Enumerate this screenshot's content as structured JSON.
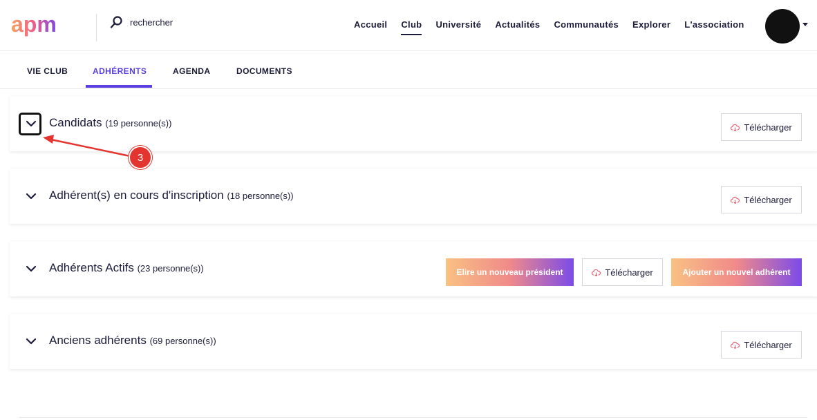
{
  "header": {
    "logo_text": "apm",
    "search": {
      "placeholder": "rechercher"
    },
    "nav": [
      {
        "label": "Accueil",
        "active": false
      },
      {
        "label": "Club",
        "active": true
      },
      {
        "label": "Université",
        "active": false
      },
      {
        "label": "Actualités",
        "active": false
      },
      {
        "label": "Communautés",
        "active": false
      },
      {
        "label": "Explorer",
        "active": false
      },
      {
        "label": "L'association",
        "active": false
      }
    ]
  },
  "subtabs": [
    {
      "label": "VIE CLUB",
      "active": false
    },
    {
      "label": "ADHÉRENTS",
      "active": true
    },
    {
      "label": "AGENDA",
      "active": false
    },
    {
      "label": "DOCUMENTS",
      "active": false
    }
  ],
  "sections": [
    {
      "title": "Candidats",
      "count": "(19 personne(s))",
      "download": "Télécharger"
    },
    {
      "title": "Adhérent(s) en cours d'inscription",
      "count": "(18 personne(s))",
      "download": "Télécharger"
    },
    {
      "title": "Adhérents Actifs",
      "count": "(23 personne(s))",
      "download": "Télécharger",
      "elect_button": "Elire un nouveau président",
      "add_button": "Ajouter un nouvel adhérent"
    },
    {
      "title": "Anciens adhérents",
      "count": "(69 personne(s))",
      "download": "Télécharger"
    }
  ],
  "annotation": {
    "step": "3",
    "color": "#e3342f"
  },
  "colors": {
    "accent": "#5b3fe0",
    "text": "#1b1b3a",
    "gradient_start": "#f9c183",
    "gradient_end": "#7b4be8"
  }
}
